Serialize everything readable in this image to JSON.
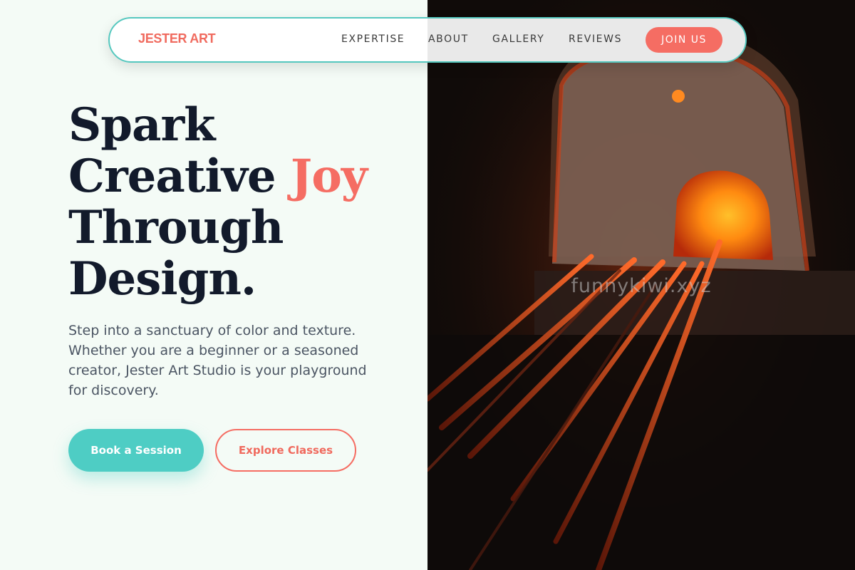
{
  "nav": {
    "brand": "JESTER ART",
    "links": [
      "EXPERTISE",
      "ABOUT",
      "GALLERY",
      "REVIEWS"
    ],
    "cta": "JOIN US"
  },
  "hero": {
    "headline": {
      "line1": "Spark",
      "line2_prefix": "Creative ",
      "line2_accent": "Joy",
      "line3": "Through",
      "line4": "Design."
    },
    "intro": "Step into a sanctuary of color and texture. Whether you are a beginner or a seasoned creator, Jester Art Studio is your playground for discovery.",
    "primary_cta": "Book a Session",
    "secondary_cta": "Explore Classes"
  },
  "media": {
    "watermark": "funnykiwi.xyz"
  },
  "colors": {
    "accent": "#f56d63",
    "teal": "#4ecdc4",
    "ink": "#121a2b",
    "background": "#f4fbf6"
  },
  "icons": [
    "furnace-photo"
  ]
}
